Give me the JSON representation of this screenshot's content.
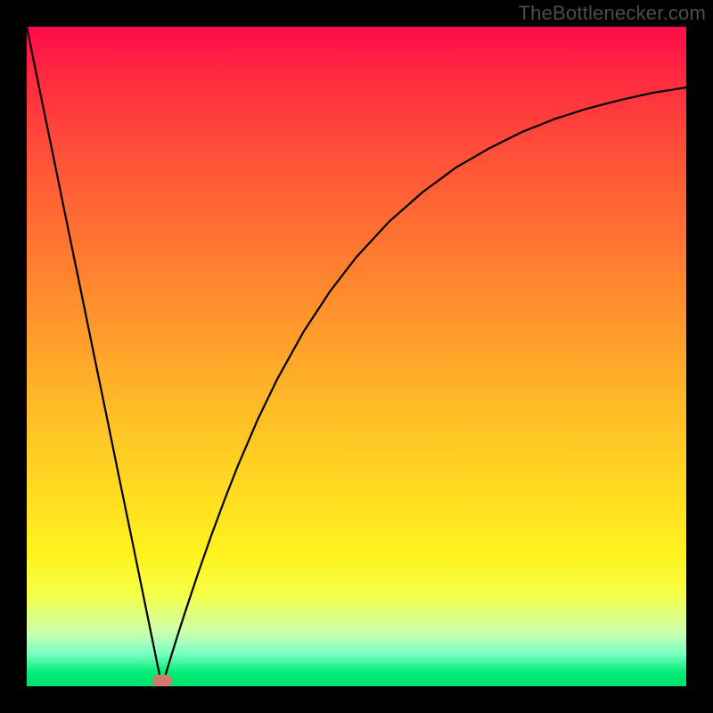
{
  "watermark": "TheBottlenecker.com",
  "chart_data": {
    "type": "line",
    "title": "",
    "xlabel": "",
    "ylabel": "",
    "xlim": [
      0,
      100
    ],
    "ylim": [
      0,
      100
    ],
    "x": [
      0,
      2,
      4,
      6,
      8,
      10,
      12,
      14,
      16,
      18,
      20,
      20.5,
      21,
      22,
      23,
      24,
      26,
      28,
      30,
      32,
      35,
      38,
      42,
      46,
      50,
      55,
      60,
      65,
      70,
      75,
      80,
      85,
      90,
      95,
      100
    ],
    "y": [
      100,
      90.2,
      80.5,
      70.7,
      61.0,
      51.2,
      41.5,
      31.7,
      22.0,
      12.2,
      2.4,
      0,
      1.6,
      4.9,
      8.1,
      11.2,
      17.2,
      22.9,
      28.3,
      33.4,
      40.4,
      46.6,
      53.8,
      59.9,
      65.1,
      70.5,
      74.9,
      78.6,
      81.5,
      84.0,
      86.0,
      87.6,
      88.9,
      90.0,
      90.8
    ],
    "marker": {
      "x": 20.5,
      "y": 0
    },
    "gradient_stops": [
      {
        "pos": 0.0,
        "color": "#ff0a4a"
      },
      {
        "pos": 0.22,
        "color": "#ff5837"
      },
      {
        "pos": 0.55,
        "color": "#ffb428"
      },
      {
        "pos": 0.8,
        "color": "#fff21e"
      },
      {
        "pos": 0.92,
        "color": "#c9ffb0"
      },
      {
        "pos": 1.0,
        "color": "#00e170"
      }
    ]
  }
}
